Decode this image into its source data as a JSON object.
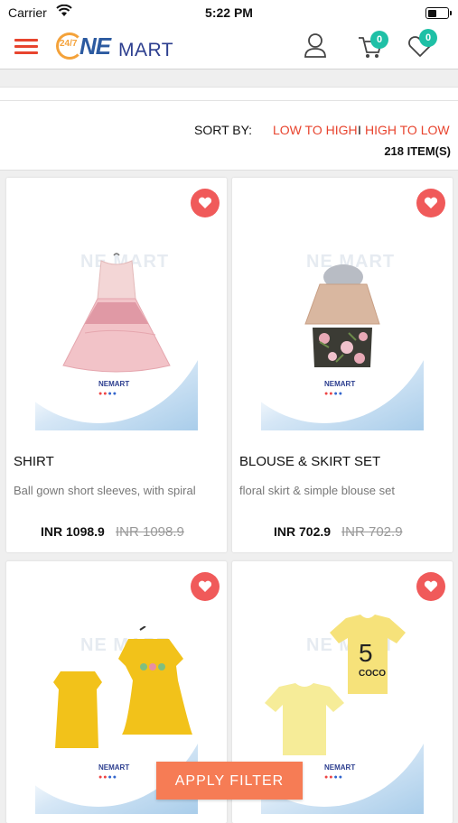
{
  "status_bar": {
    "carrier": "Carrier",
    "time": "5:22 PM"
  },
  "header": {
    "logo": {
      "prefix": "24/7",
      "ne": "NE",
      "mart": "MART"
    },
    "cart_count": "0",
    "wishlist_count": "0"
  },
  "sort": {
    "label": "SORT BY:",
    "low_to_high": "LOW TO HIGH",
    "separator": "I",
    "high_to_low": "HIGH TO LOW",
    "item_count": "218 ITEM(S)"
  },
  "products": [
    {
      "title": "SHIRT",
      "description": "Ball gown short sleeves, with spiral",
      "price": "INR 1098.9",
      "old_price": "INR 1098.9"
    },
    {
      "title": "BLOUSE & SKIRT SET",
      "description": "floral skirt & simple blouse set",
      "price": "INR 702.9",
      "old_price": "INR 702.9"
    },
    {
      "title": "",
      "description": "",
      "price": "",
      "old_price": ""
    },
    {
      "title": "",
      "description": "",
      "price": "",
      "old_price": ""
    }
  ],
  "apply_filter_label": "APPLY FILTER",
  "colors": {
    "accent": "#e8442e",
    "badge": "#1fc0a6",
    "heart": "#f05a5a",
    "apply": "#f67c55"
  }
}
